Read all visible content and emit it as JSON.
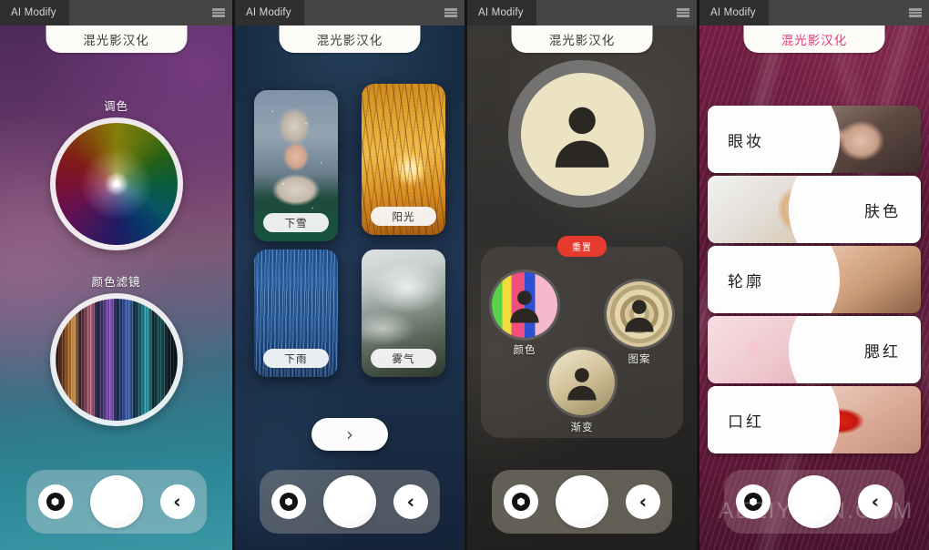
{
  "window": {
    "tab_label": "AI Modify",
    "menu_icon": "hamburger-icon"
  },
  "panels": [
    {
      "id": "color-tools",
      "title": "混光影汉化",
      "title_color": "#3a3a3a",
      "sections": [
        {
          "label": "调色",
          "icon": "color-wheel"
        },
        {
          "label": "颜色滤镜",
          "icon": "color-filter"
        }
      ],
      "bottom_bar": {
        "camera_icon": "hexagon-camera-icon",
        "shutter_icon": "shutter-button",
        "back_icon": "chevron-left-icon"
      }
    },
    {
      "id": "weather-effects",
      "title": "混光影汉化",
      "title_color": "#3a3a3a",
      "cards": [
        {
          "label": "下雪",
          "image": "snow-portrait"
        },
        {
          "label": "阳光",
          "image": "sunlight-grass"
        },
        {
          "label": "下雨",
          "image": "rain-blue"
        },
        {
          "label": "雾气",
          "image": "fog-mountain"
        }
      ],
      "next_button": {
        "icon": "chevron-right-icon"
      },
      "bottom_bar": {
        "camera_icon": "hexagon-camera-icon",
        "shutter_icon": "shutter-button",
        "back_icon": "chevron-left-icon"
      }
    },
    {
      "id": "avatar-style",
      "title": "混光影汉化",
      "title_color": "#3a3a3a",
      "avatar": {
        "icon": "person-icon"
      },
      "badge": "重置",
      "effects": [
        {
          "label": "颜色",
          "icon": "person-icon",
          "style": "color-stripes"
        },
        {
          "label": "图案",
          "icon": "person-icon",
          "style": "ring-pattern"
        },
        {
          "label": "渐变",
          "icon": "person-icon",
          "style": "gradient"
        }
      ],
      "bottom_bar": {
        "camera_icon": "hexagon-camera-icon",
        "shutter_icon": "shutter-button",
        "back_icon": "chevron-left-icon"
      }
    },
    {
      "id": "makeup-menu",
      "title": "混光影汉化",
      "title_color": "#e8377f",
      "items": [
        {
          "label": "眼妆",
          "align": "left",
          "image": "eye-makeup-photo"
        },
        {
          "label": "肤色",
          "align": "right",
          "image": "skin-tone-photo"
        },
        {
          "label": "轮廓",
          "align": "left",
          "image": "contour-photo"
        },
        {
          "label": "腮红",
          "align": "right",
          "image": "blush-photo"
        },
        {
          "label": "口红",
          "align": "left",
          "image": "lipstick-photo"
        }
      ],
      "watermark": "AEZIYUAN.COM",
      "bottom_bar": {
        "camera_icon": "hexagon-camera-icon",
        "shutter_icon": "shutter-button",
        "back_icon": "chevron-left-icon"
      }
    }
  ],
  "glyphs": {
    "chevron_left": "‹",
    "chevron_right": "›"
  }
}
